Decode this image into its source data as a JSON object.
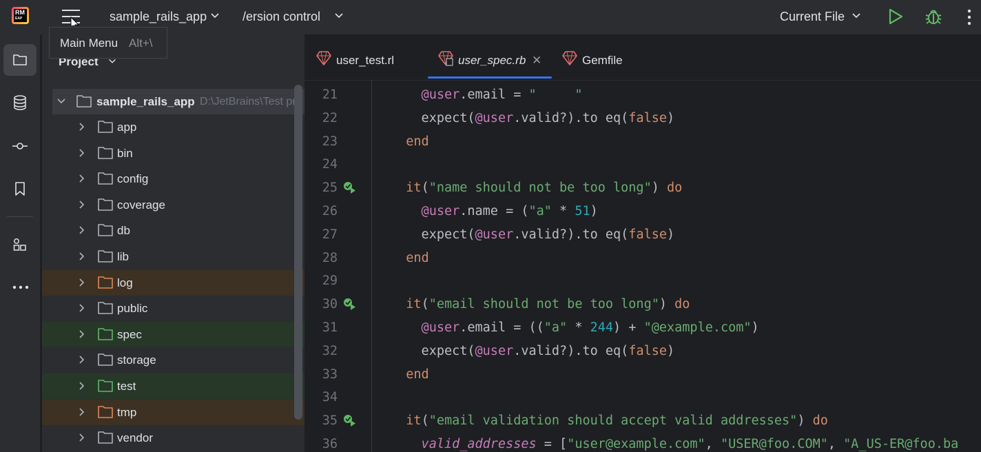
{
  "titlebar": {
    "logo_text": "RM",
    "logo_sub": "EAP",
    "project_name": "sample_rails_app",
    "vcs_label": "/ersion control",
    "run_config": "Current File"
  },
  "tooltip": {
    "title": "Main Menu",
    "shortcut": "Alt+\\"
  },
  "project_panel": {
    "header": "Project",
    "root": {
      "name": "sample_rails_app",
      "path": "D:\\JetBrains\\Test pr"
    },
    "folders": [
      {
        "name": "app",
        "status": "normal"
      },
      {
        "name": "bin",
        "status": "normal"
      },
      {
        "name": "config",
        "status": "normal"
      },
      {
        "name": "coverage",
        "status": "normal"
      },
      {
        "name": "db",
        "status": "normal"
      },
      {
        "name": "lib",
        "status": "normal"
      },
      {
        "name": "log",
        "status": "excluded"
      },
      {
        "name": "public",
        "status": "normal"
      },
      {
        "name": "spec",
        "status": "test"
      },
      {
        "name": "storage",
        "status": "normal"
      },
      {
        "name": "test",
        "status": "test"
      },
      {
        "name": "tmp",
        "status": "excluded"
      },
      {
        "name": "vendor",
        "status": "normal"
      }
    ]
  },
  "tabs": [
    {
      "label": "user_test.rl",
      "active": false
    },
    {
      "label": "user_spec.rb",
      "active": true
    },
    {
      "label": "Gemfile",
      "active": false
    }
  ],
  "colors": {
    "accent": "#3574f0",
    "keyword": "#cf8e6d",
    "ivar": "#c77dbb",
    "string": "#6aab73",
    "number": "#2aacb8",
    "folder_excluded": "#e08855",
    "folder_test": "#5fb865"
  },
  "code_lines": [
    {
      "n": "21",
      "tokens": [
        [
          "iv",
          "    @user"
        ],
        [
          "id",
          ".email = "
        ],
        [
          "str",
          "\"     \""
        ]
      ]
    },
    {
      "n": "22",
      "tokens": [
        [
          "id",
          "    expect("
        ],
        [
          "iv",
          "@user"
        ],
        [
          "id",
          ".valid?).to eq("
        ],
        [
          "kw",
          "false"
        ],
        [
          "id",
          ")"
        ]
      ]
    },
    {
      "n": "23",
      "tokens": [
        [
          "kw",
          "  end"
        ]
      ]
    },
    {
      "n": "24",
      "tokens": []
    },
    {
      "n": "25",
      "run": true,
      "tokens": [
        [
          "kw",
          "  it"
        ],
        [
          "id",
          "("
        ],
        [
          "str",
          "\"name should not be too long\""
        ],
        [
          "id",
          ") "
        ],
        [
          "kw",
          "do"
        ]
      ]
    },
    {
      "n": "26",
      "tokens": [
        [
          "iv",
          "    @user"
        ],
        [
          "id",
          ".name = ("
        ],
        [
          "str",
          "\"a\""
        ],
        [
          "id",
          " * "
        ],
        [
          "num",
          "51"
        ],
        [
          "id",
          ")"
        ]
      ]
    },
    {
      "n": "27",
      "tokens": [
        [
          "id",
          "    expect("
        ],
        [
          "iv",
          "@user"
        ],
        [
          "id",
          ".valid?).to eq("
        ],
        [
          "kw",
          "false"
        ],
        [
          "id",
          ")"
        ]
      ]
    },
    {
      "n": "28",
      "tokens": [
        [
          "kw",
          "  end"
        ]
      ]
    },
    {
      "n": "29",
      "tokens": []
    },
    {
      "n": "30",
      "run": true,
      "tokens": [
        [
          "kw",
          "  it"
        ],
        [
          "id",
          "("
        ],
        [
          "str",
          "\"email should not be too long\""
        ],
        [
          "id",
          ") "
        ],
        [
          "kw",
          "do"
        ]
      ]
    },
    {
      "n": "31",
      "tokens": [
        [
          "iv",
          "    @user"
        ],
        [
          "id",
          ".email = (("
        ],
        [
          "str",
          "\"a\""
        ],
        [
          "id",
          " * "
        ],
        [
          "num",
          "244"
        ],
        [
          "id",
          ") + "
        ],
        [
          "str",
          "\"@example.com\""
        ],
        [
          "id",
          ")"
        ]
      ]
    },
    {
      "n": "32",
      "tokens": [
        [
          "id",
          "    expect("
        ],
        [
          "iv",
          "@user"
        ],
        [
          "id",
          ".valid?).to eq("
        ],
        [
          "kw",
          "false"
        ],
        [
          "id",
          ")"
        ]
      ]
    },
    {
      "n": "33",
      "tokens": [
        [
          "kw",
          "  end"
        ]
      ]
    },
    {
      "n": "34",
      "tokens": []
    },
    {
      "n": "35",
      "run": true,
      "tokens": [
        [
          "kw",
          "  it"
        ],
        [
          "id",
          "("
        ],
        [
          "str",
          "\"email validation should accept valid addresses\""
        ],
        [
          "id",
          ") "
        ],
        [
          "kw",
          "do"
        ]
      ]
    },
    {
      "n": "36",
      "tokens": [
        [
          "lv",
          "    valid_addresses"
        ],
        [
          "id",
          " = ["
        ],
        [
          "str",
          "\"user@example.com\""
        ],
        [
          "id",
          ", "
        ],
        [
          "str",
          "\"USER@foo.COM\""
        ],
        [
          "id",
          ", "
        ],
        [
          "str",
          "\"A_US-ER@foo.ba"
        ]
      ]
    }
  ]
}
